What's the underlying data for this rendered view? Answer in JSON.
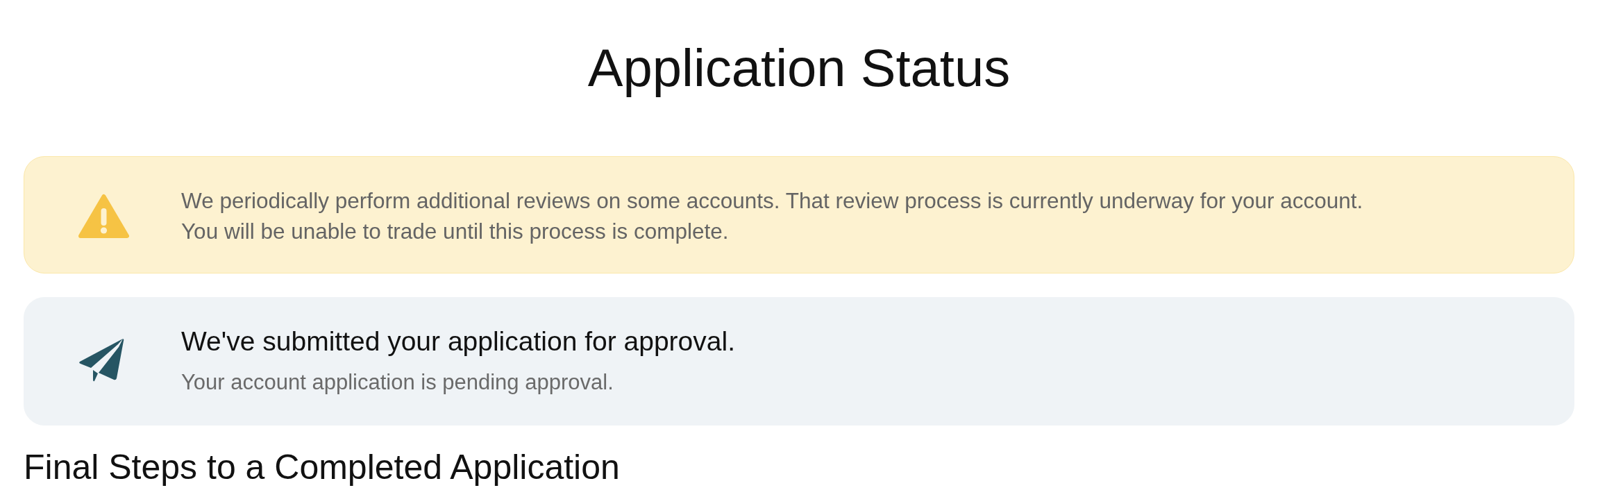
{
  "page": {
    "title": "Application Status"
  },
  "notices": [
    {
      "kind": "warning",
      "message_lines": [
        "We periodically perform additional reviews on some accounts. That review process is currently underway for your account.",
        "You will be unable to trade until this process is complete."
      ]
    },
    {
      "kind": "submitted",
      "heading": "We've submitted your application for approval.",
      "message_lines": [
        "Your account application is pending approval."
      ]
    }
  ],
  "section_heading": "Final Steps to a Completed Application"
}
